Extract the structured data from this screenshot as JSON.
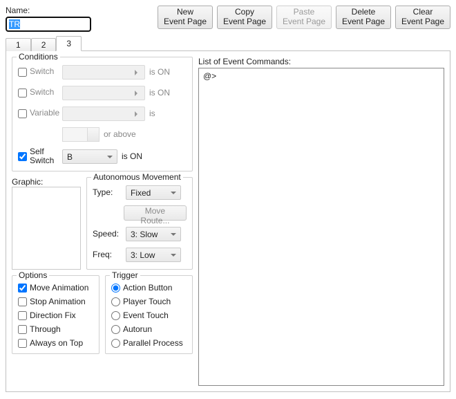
{
  "name_label": "Name:",
  "name_value": "TR",
  "buttons": {
    "new1": "New",
    "new2": "Event Page",
    "copy1": "Copy",
    "copy2": "Event Page",
    "paste1": "Paste",
    "paste2": "Event Page",
    "delete1": "Delete",
    "delete2": "Event Page",
    "clear1": "Clear",
    "clear2": "Event Page"
  },
  "tabs": {
    "t1": "1",
    "t2": "2",
    "t3": "3"
  },
  "groups": {
    "conditions": "Conditions",
    "graphic": "Graphic:",
    "autonomous": "Autonomous Movement",
    "options": "Options",
    "trigger": "Trigger",
    "commands": "List of Event Commands:"
  },
  "cond": {
    "switch": "Switch",
    "variable": "Variable",
    "self_switch": "Self\nSwitch",
    "is_on": "is ON",
    "is": "is",
    "or_above": "or above",
    "self_switch_value": "B"
  },
  "auto": {
    "type": "Type:",
    "type_val": "Fixed",
    "move_route": "Move Route...",
    "speed": "Speed:",
    "speed_val": "3: Slow",
    "freq": "Freq:",
    "freq_val": "3: Low"
  },
  "options": {
    "move_anim": "Move Animation",
    "stop_anim": "Stop Animation",
    "dir_fix": "Direction Fix",
    "through": "Through",
    "always_top": "Always on Top"
  },
  "trigger": {
    "action": "Action Button",
    "player": "Player Touch",
    "event": "Event Touch",
    "autorun": "Autorun",
    "parallel": "Parallel Process"
  },
  "commands_first": "@>"
}
